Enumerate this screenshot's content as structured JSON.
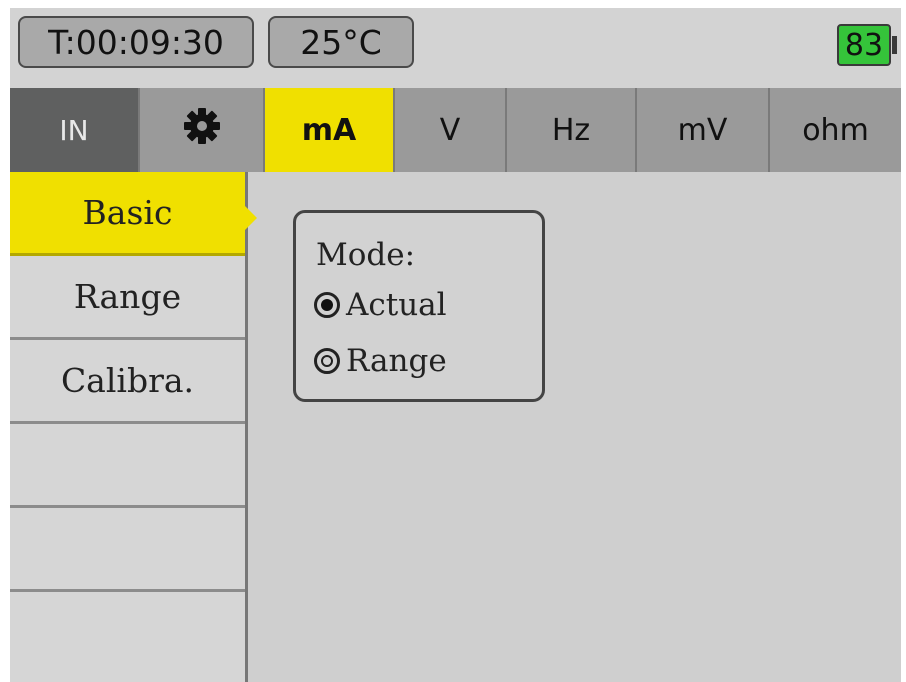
{
  "status": {
    "timer": "T:00:09:30",
    "temperature": "25°C",
    "battery": "83"
  },
  "tabs": [
    {
      "label": "IN"
    },
    {
      "icon": "gear-icon"
    },
    {
      "label": "mA",
      "active": true
    },
    {
      "label": "V"
    },
    {
      "label": "Hz"
    },
    {
      "label": "mV"
    },
    {
      "label": "ohm"
    }
  ],
  "menu": {
    "items": [
      {
        "label": "Basic",
        "active": true
      },
      {
        "label": "Range"
      },
      {
        "label": "Calibra."
      },
      {
        "label": ""
      },
      {
        "label": ""
      },
      {
        "label": ""
      }
    ]
  },
  "mode_panel": {
    "title": "Mode:",
    "options": [
      {
        "label": "Actual",
        "selected": true
      },
      {
        "label": "Range",
        "selected": false
      }
    ]
  },
  "colors": {
    "accent_yellow": "#f0e000",
    "battery_green": "#35c43a",
    "in_tab": "#5f6060"
  }
}
